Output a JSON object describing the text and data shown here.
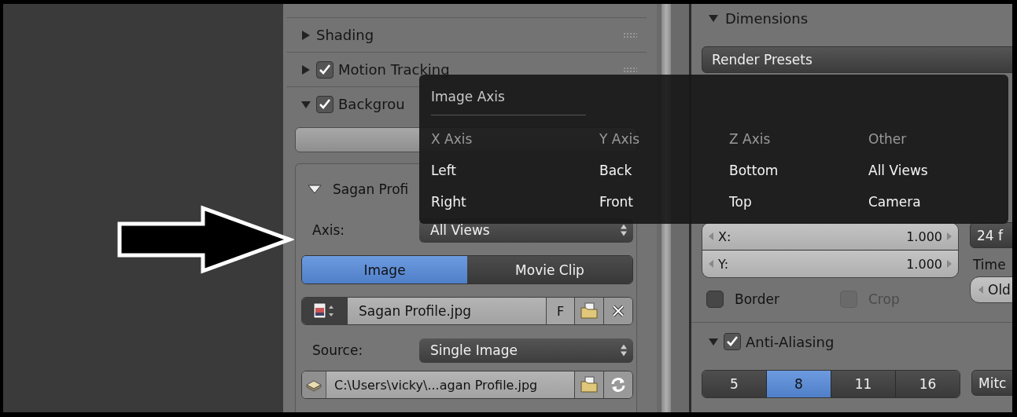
{
  "left_panel": {
    "sections": [
      {
        "kind": "plain",
        "title": "Shading",
        "expanded": false
      },
      {
        "kind": "toggle",
        "title": "Motion Tracking",
        "expanded": false,
        "checked": true
      },
      {
        "kind": "toggle",
        "title": "Backgrou",
        "expanded": true,
        "checked": true
      }
    ],
    "background_image": {
      "title": "Sagan Profi",
      "expanded": true,
      "axis_label": "Axis:",
      "axis_value": "All Views",
      "source_tabs": [
        {
          "label": "Image",
          "selected": true
        },
        {
          "label": "Movie Clip",
          "selected": false
        }
      ],
      "file_name": "Sagan Profile.jpg",
      "fake_user": "F",
      "source_label": "Source:",
      "source_value": "Single Image",
      "path": "C:\\Users\\vicky\\...agan Profile.jpg"
    }
  },
  "right_panel": {
    "dimensions": {
      "title": "Dimensions",
      "expanded": true
    },
    "render_presets": "Render Presets",
    "aspect_fields": [
      {
        "label": "X:",
        "value": "1.000"
      },
      {
        "label": "Y:",
        "value": "1.000"
      }
    ],
    "options": [
      {
        "label": "Border",
        "checked": false,
        "disabled": false
      },
      {
        "label": "Crop",
        "checked": false,
        "disabled": true
      }
    ],
    "frame_rate": "24 f",
    "time_label": "Time",
    "time_value": "Old",
    "anti_aliasing": {
      "title": "Anti-Aliasing",
      "expanded": true,
      "checked": true,
      "samples": [
        {
          "label": "5",
          "selected": false
        },
        {
          "label": "8",
          "selected": true
        },
        {
          "label": "11",
          "selected": false
        },
        {
          "label": "16",
          "selected": false
        }
      ],
      "filter": "Mitc"
    }
  },
  "popup_menu": {
    "title": "Image Axis",
    "columns": [
      {
        "heading": "X Axis",
        "items": [
          "Left",
          "Right"
        ]
      },
      {
        "heading": "Y Axis",
        "items": [
          "Back",
          "Front"
        ]
      },
      {
        "heading": "Z Axis",
        "items": [
          "Bottom",
          "Top"
        ]
      },
      {
        "heading": "Other",
        "items": [
          "All Views",
          "Camera"
        ]
      }
    ]
  }
}
